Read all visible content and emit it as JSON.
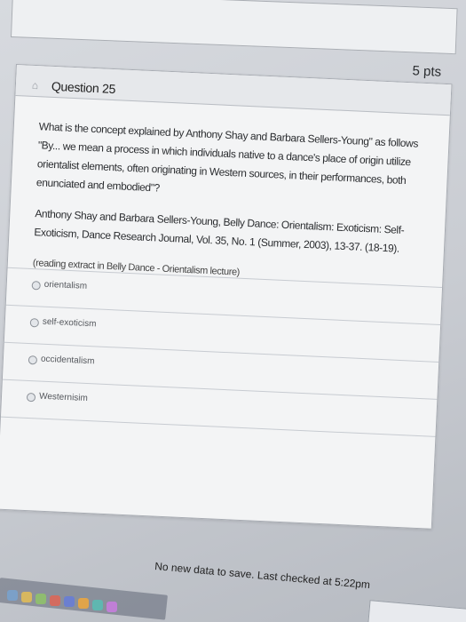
{
  "question": {
    "title": "Question 25",
    "points": "5 pts",
    "prompt": "What is the concept explained by Anthony Shay and Barbara Sellers-Young\" as follows \"By... we mean a process in which individuals native to a dance's place of origin utilize orientalist elements, often originating in Western sources, in their performances, both enunciated and embodied\"?",
    "citation": "Anthony Shay and Barbara Sellers-Young, Belly Dance: Orientalism: Exoticism: Self-Exoticism, Dance Research Journal, Vol. 35, No. 1 (Summer, 2003), 13-37. (18-19).",
    "note": "(reading extract in Belly Dance - Orientalism lecture)",
    "answers": [
      "orientalism",
      "self-exoticism",
      "occidentalism",
      "Westernisim"
    ]
  },
  "status_text": "No new data to save. Last checked at 5:22pm",
  "icons": {
    "flag": "flag-icon",
    "radio": "radio-icon"
  },
  "colors": {
    "card_bg": "#f3f4f5",
    "border": "#a7abb2"
  }
}
